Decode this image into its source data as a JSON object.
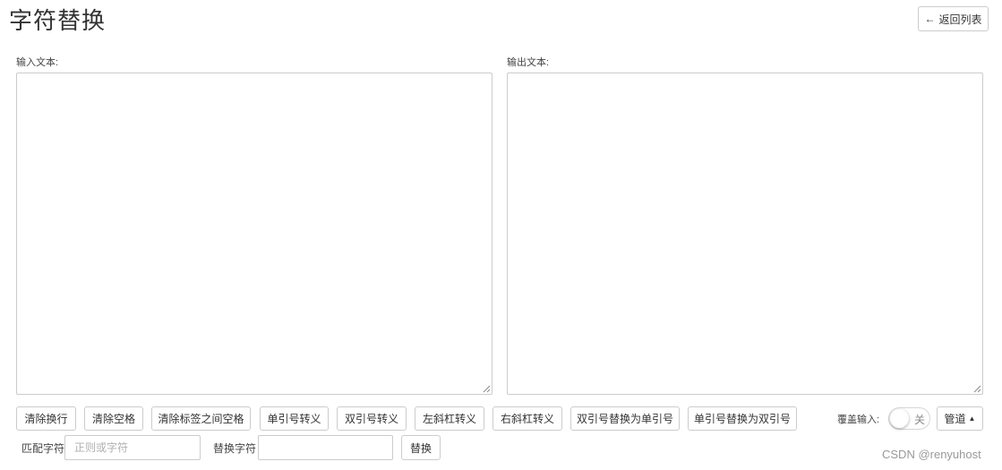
{
  "page": {
    "title": "字符替换",
    "back_label": "返回列表"
  },
  "input_panel": {
    "label": "输入文本:",
    "value": ""
  },
  "output_panel": {
    "label": "输出文本:",
    "value": ""
  },
  "toolbar": {
    "buttons": [
      "清除换行",
      "清除空格",
      "清除标签之间空格",
      "单引号转义",
      "双引号转义",
      "左斜杠转义",
      "右斜杠转义",
      "双引号替换为单引号",
      "单引号替换为双引号"
    ],
    "overwrite_label": "覆盖输入:",
    "overwrite_toggle": {
      "state": "关"
    },
    "pipe_label": "管道"
  },
  "replace": {
    "match_label": "匹配字符",
    "match_placeholder": "正则或字符",
    "match_value": "",
    "replace_label": "替换字符",
    "replace_value": "",
    "button_label": "替换"
  },
  "watermark": "CSDN @renyuhost",
  "icons": {
    "back": "arrow-left-icon",
    "pipe_caret": "caret-up-icon",
    "resize": "resize-grip-icon"
  },
  "colors": {
    "border": "#cccccc",
    "text": "#333333",
    "placeholder": "#b0b0b0",
    "watermark": "#999999"
  }
}
